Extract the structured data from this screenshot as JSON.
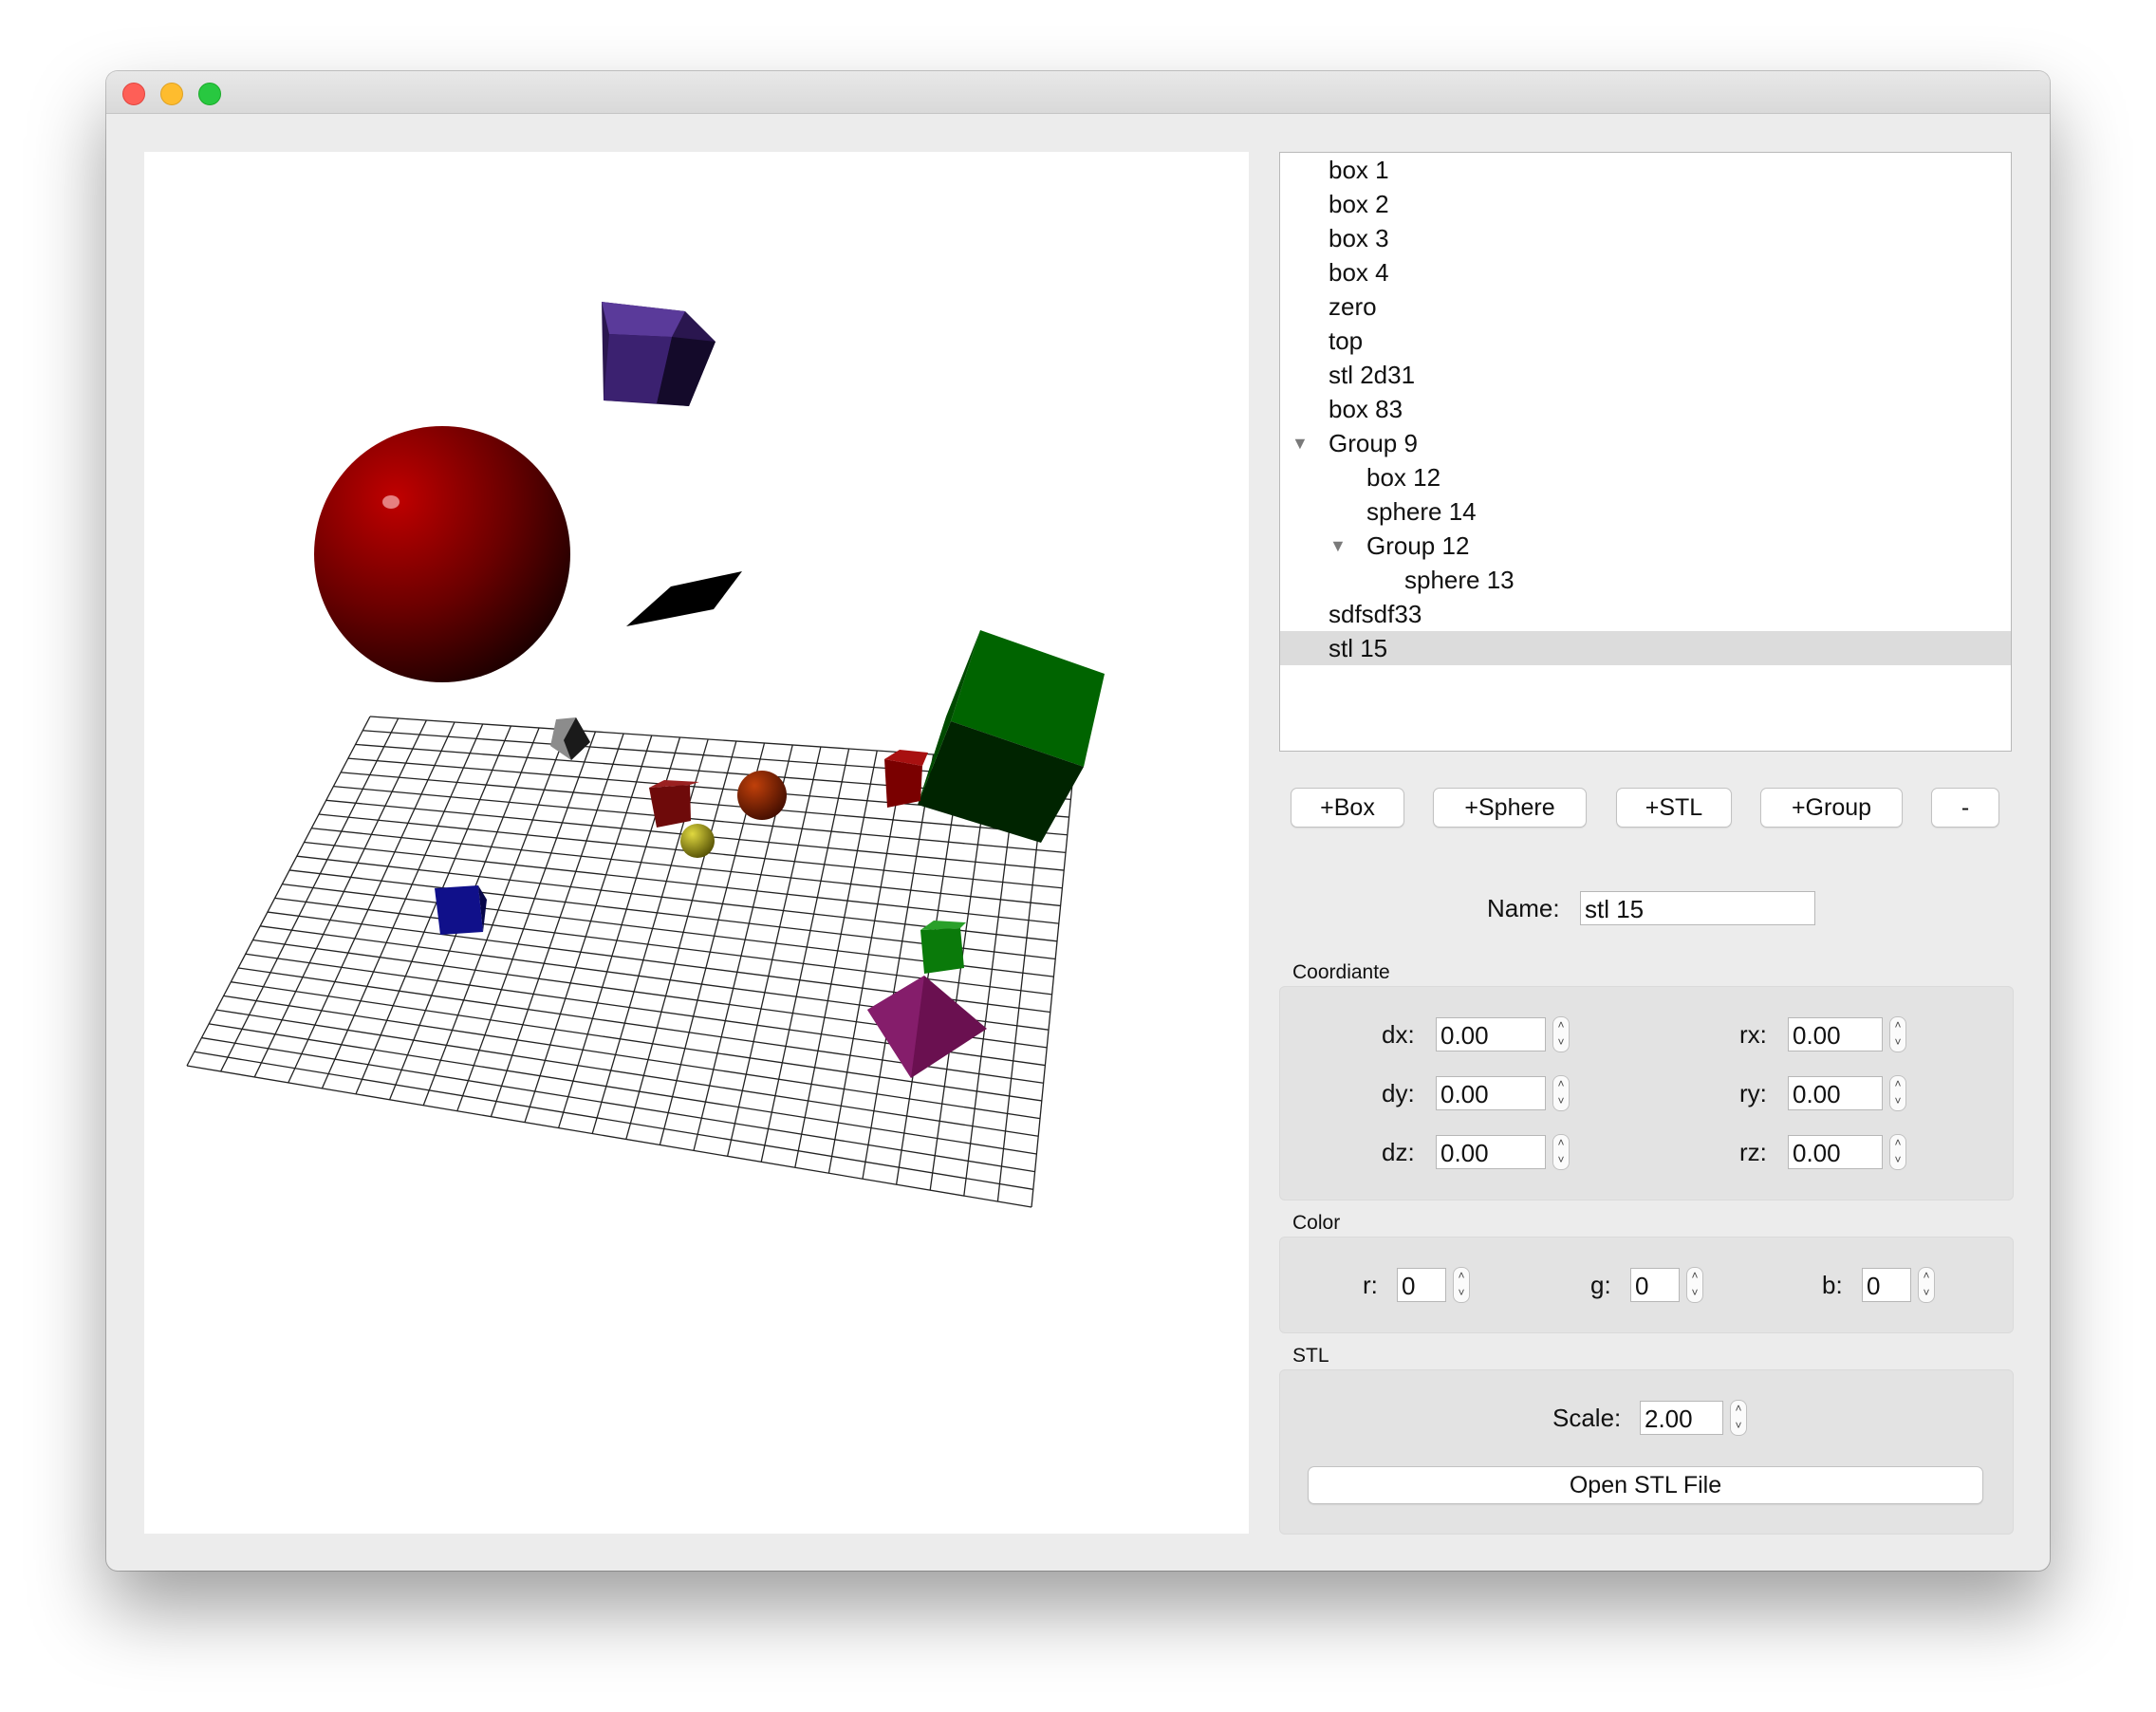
{
  "window": {
    "title": ""
  },
  "scene_tree": {
    "items": [
      {
        "label": "box 1",
        "depth": 0,
        "expanded": null,
        "selected": false
      },
      {
        "label": "box 2",
        "depth": 0,
        "expanded": null,
        "selected": false
      },
      {
        "label": "box 3",
        "depth": 0,
        "expanded": null,
        "selected": false
      },
      {
        "label": "box 4",
        "depth": 0,
        "expanded": null,
        "selected": false
      },
      {
        "label": "zero",
        "depth": 0,
        "expanded": null,
        "selected": false
      },
      {
        "label": "top",
        "depth": 0,
        "expanded": null,
        "selected": false
      },
      {
        "label": "stl 2d31",
        "depth": 0,
        "expanded": null,
        "selected": false
      },
      {
        "label": "box 83",
        "depth": 0,
        "expanded": null,
        "selected": false
      },
      {
        "label": "Group 9",
        "depth": 0,
        "expanded": true,
        "selected": false
      },
      {
        "label": "box 12",
        "depth": 1,
        "expanded": null,
        "selected": false
      },
      {
        "label": "sphere 14",
        "depth": 1,
        "expanded": null,
        "selected": false
      },
      {
        "label": "Group 12",
        "depth": 1,
        "expanded": true,
        "selected": false
      },
      {
        "label": "sphere 13",
        "depth": 2,
        "expanded": null,
        "selected": false
      },
      {
        "label": "sdfsdf33",
        "depth": 0,
        "expanded": null,
        "selected": false
      },
      {
        "label": "stl 15",
        "depth": 0,
        "expanded": null,
        "selected": true
      }
    ]
  },
  "toolbar": {
    "add_box": "+Box",
    "add_sphere": "+Sphere",
    "add_stl": "+STL",
    "add_group": "+Group",
    "remove": "-"
  },
  "properties": {
    "name_label": "Name:",
    "name_value": "stl 15",
    "coordinate_title": "Coordiante",
    "dx_label": "dx:",
    "dx": "0.00",
    "dy_label": "dy:",
    "dy": "0.00",
    "dz_label": "dz:",
    "dz": "0.00",
    "rx_label": "rx:",
    "rx": "0.00",
    "ry_label": "ry:",
    "ry": "0.00",
    "rz_label": "rz:",
    "rz": "0.00",
    "color_title": "Color",
    "r_label": "r:",
    "r": "0",
    "g_label": "g:",
    "g": "0",
    "b_label": "b:",
    "b": "0",
    "stl_title": "STL",
    "scale_label": "Scale:",
    "scale": "2.00",
    "open_stl": "Open STL File"
  },
  "spin_icons": {
    "up": "chevron-up-icon",
    "down": "chevron-down-icon"
  },
  "viewport": {
    "object_colors": {
      "red_sphere": "#7a0000",
      "purple_box": "#3b2170",
      "black_plane": "#000000",
      "green_cube": "#005e00",
      "gray_cube": "#8c8c8c",
      "dark_red_cube": "#6e0a0a",
      "orange_sphere": "#8a2a00",
      "yellow_sphere": "#8a8a10",
      "red_cube": "#7a0000",
      "blue_cube": "#10108a",
      "small_green_cube": "#0a7a0a",
      "magenta_shape": "#6a1050"
    }
  }
}
